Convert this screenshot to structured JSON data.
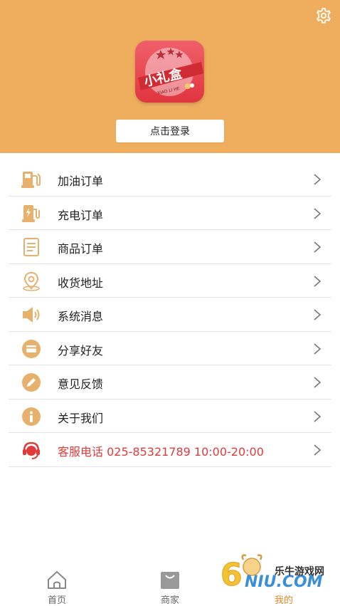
{
  "header": {
    "settings_icon": "gear-icon",
    "logo": {
      "text_main": "小礼盒",
      "text_sub": "XIAO LI HE"
    },
    "login_label": "点击登录",
    "background": "#efae5e"
  },
  "menu": {
    "items": [
      {
        "label": "加油订单",
        "icon": "fuel-pump-icon"
      },
      {
        "label": "充电订单",
        "icon": "charging-station-icon"
      },
      {
        "label": "商品订单",
        "icon": "document-icon"
      },
      {
        "label": "收货地址",
        "icon": "location-pin-icon"
      },
      {
        "label": "系统消息",
        "icon": "speaker-icon"
      },
      {
        "label": "分享好友",
        "icon": "card-icon"
      },
      {
        "label": "意见反馈",
        "icon": "pencil-icon"
      },
      {
        "label": "关于我们",
        "icon": "info-icon"
      },
      {
        "label": "客服电话 025-85321789 10:00-20:00",
        "icon": "headset-icon",
        "color": "#e03a3a"
      }
    ]
  },
  "tabbar": {
    "tabs": [
      {
        "label": "首页",
        "icon": "home-icon"
      },
      {
        "label": "商家",
        "icon": "shopping-bag-icon"
      },
      {
        "label": "我的",
        "icon": "profile-icon",
        "active": true
      }
    ],
    "active_color": "#e28a2b"
  },
  "watermark": {
    "text": "乐牛游戏网",
    "brand": "6NIU.COM"
  }
}
